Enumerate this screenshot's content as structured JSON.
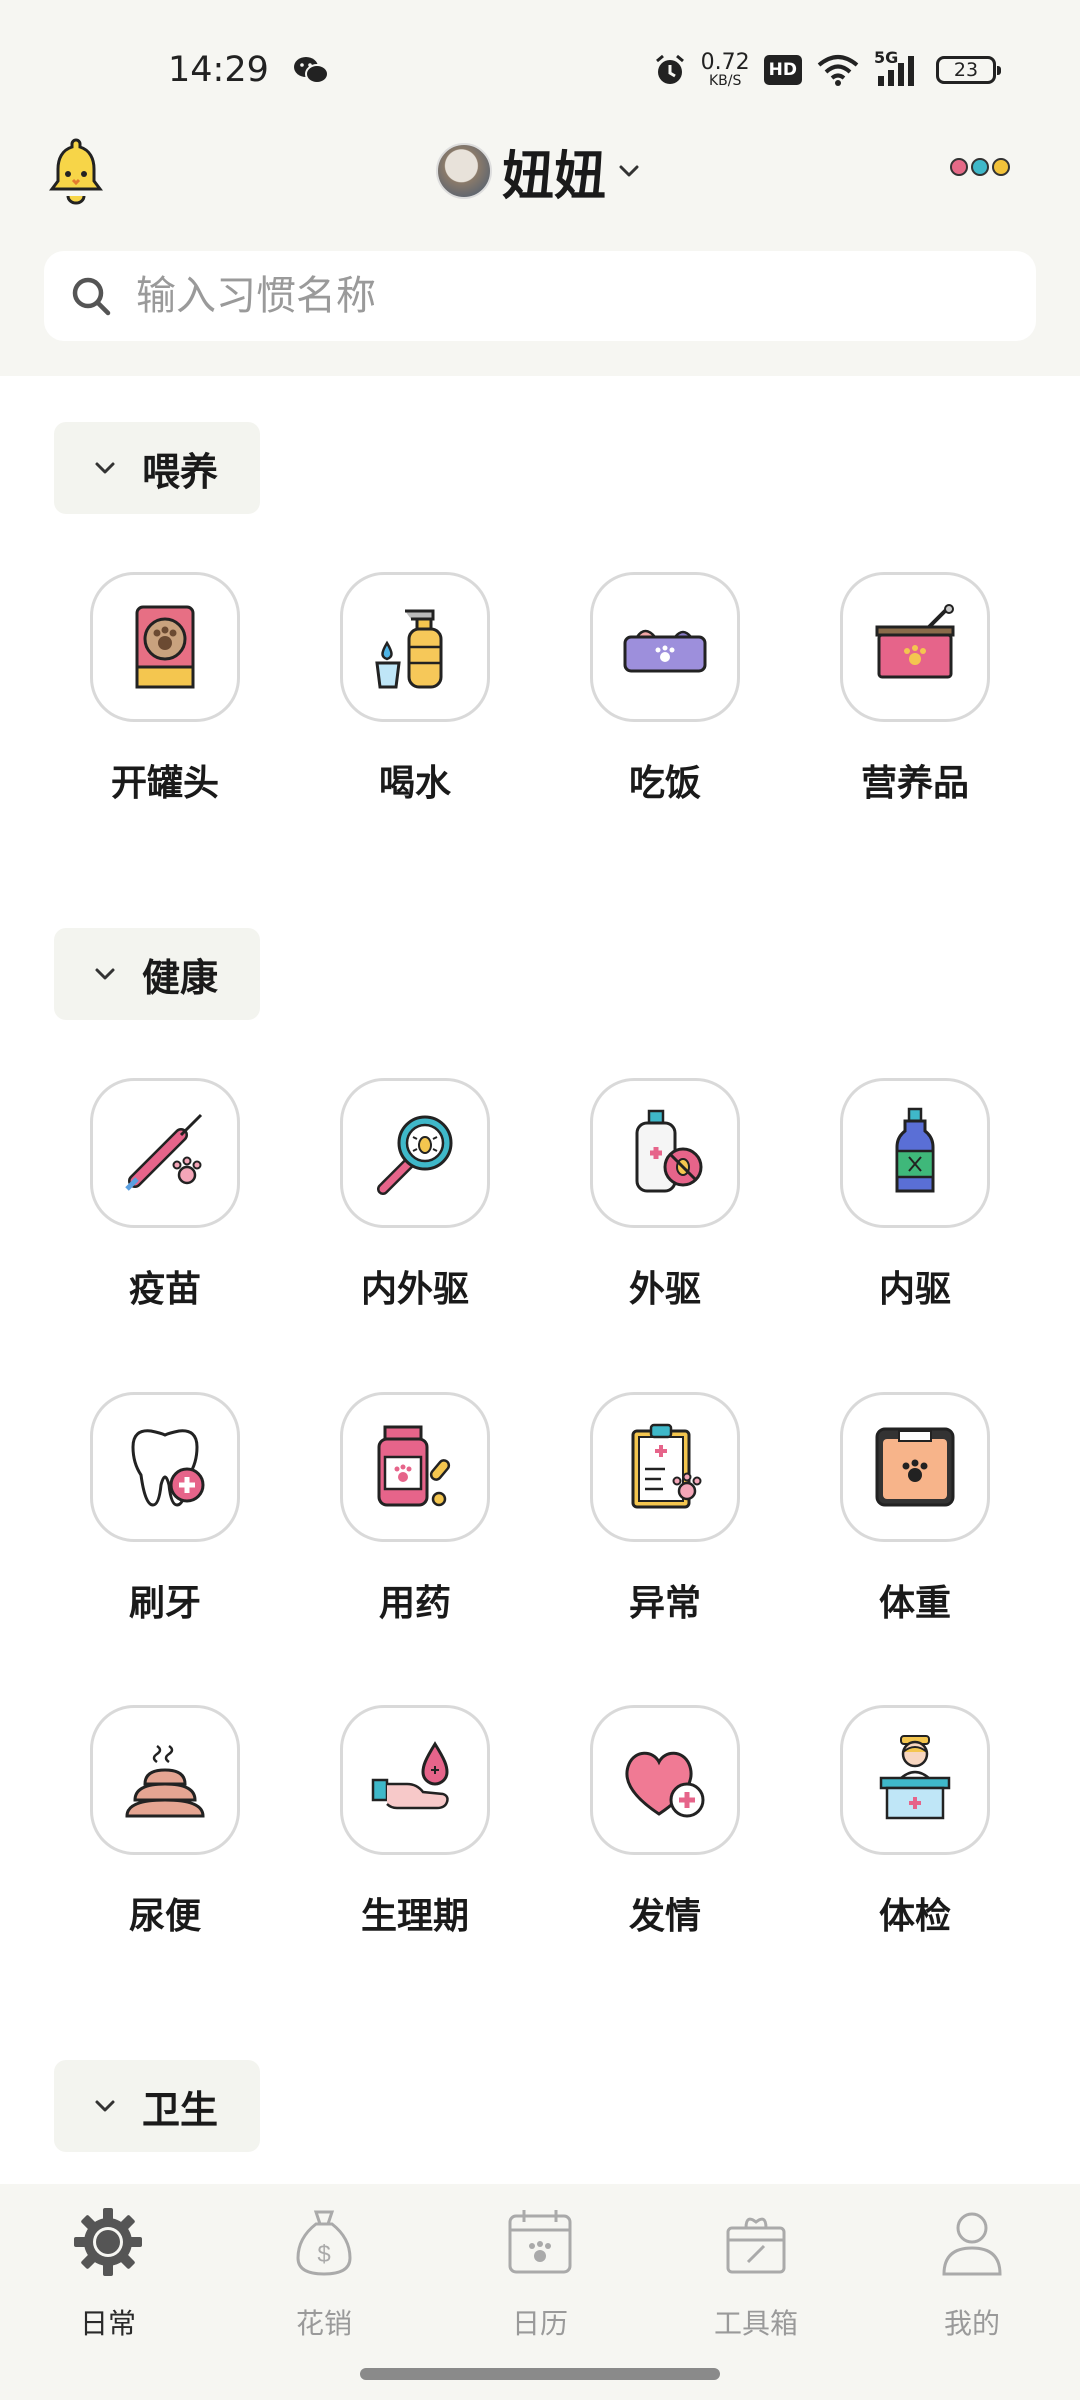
{
  "status_bar": {
    "time": "14:29",
    "net_speed": "0.72",
    "net_unit": "KB/S",
    "hd": "HD",
    "signal": "5G",
    "battery": "23"
  },
  "header": {
    "pet_name": "妞妞",
    "bell_icon": "bell-icon",
    "menu_dot_colors": [
      "#e56a87",
      "#3fb8c9",
      "#f2c23a"
    ]
  },
  "search": {
    "placeholder": "输入习惯名称"
  },
  "sections": [
    {
      "title": "喂养",
      "items": [
        {
          "label": "开罐头",
          "icon": "canned-food-icon"
        },
        {
          "label": "喝水",
          "icon": "water-bottle-icon"
        },
        {
          "label": "吃饭",
          "icon": "food-bowl-icon"
        },
        {
          "label": "营养品",
          "icon": "supplement-icon"
        }
      ]
    },
    {
      "title": "健康",
      "items": [
        {
          "label": "疫苗",
          "icon": "vaccine-icon"
        },
        {
          "label": "内外驱",
          "icon": "magnifier-bug-icon"
        },
        {
          "label": "外驱",
          "icon": "spray-no-bug-icon"
        },
        {
          "label": "内驱",
          "icon": "deworm-bottle-icon"
        },
        {
          "label": "刷牙",
          "icon": "tooth-icon"
        },
        {
          "label": "用药",
          "icon": "medicine-icon"
        },
        {
          "label": "异常",
          "icon": "clipboard-icon"
        },
        {
          "label": "体重",
          "icon": "scale-icon"
        },
        {
          "label": "尿便",
          "icon": "poop-icon"
        },
        {
          "label": "生理期",
          "icon": "hand-drop-icon"
        },
        {
          "label": "发情",
          "icon": "heart-plus-icon"
        },
        {
          "label": "体检",
          "icon": "vet-nurse-icon"
        }
      ]
    },
    {
      "title": "卫生",
      "items": []
    }
  ],
  "bottom_nav": [
    {
      "label": "日常",
      "icon": "gear-icon",
      "active": true
    },
    {
      "label": "花销",
      "icon": "money-bag-icon",
      "active": false
    },
    {
      "label": "日历",
      "icon": "calendar-icon",
      "active": false
    },
    {
      "label": "工具箱",
      "icon": "toolbox-icon",
      "active": false
    },
    {
      "label": "我的",
      "icon": "person-icon",
      "active": false
    }
  ]
}
